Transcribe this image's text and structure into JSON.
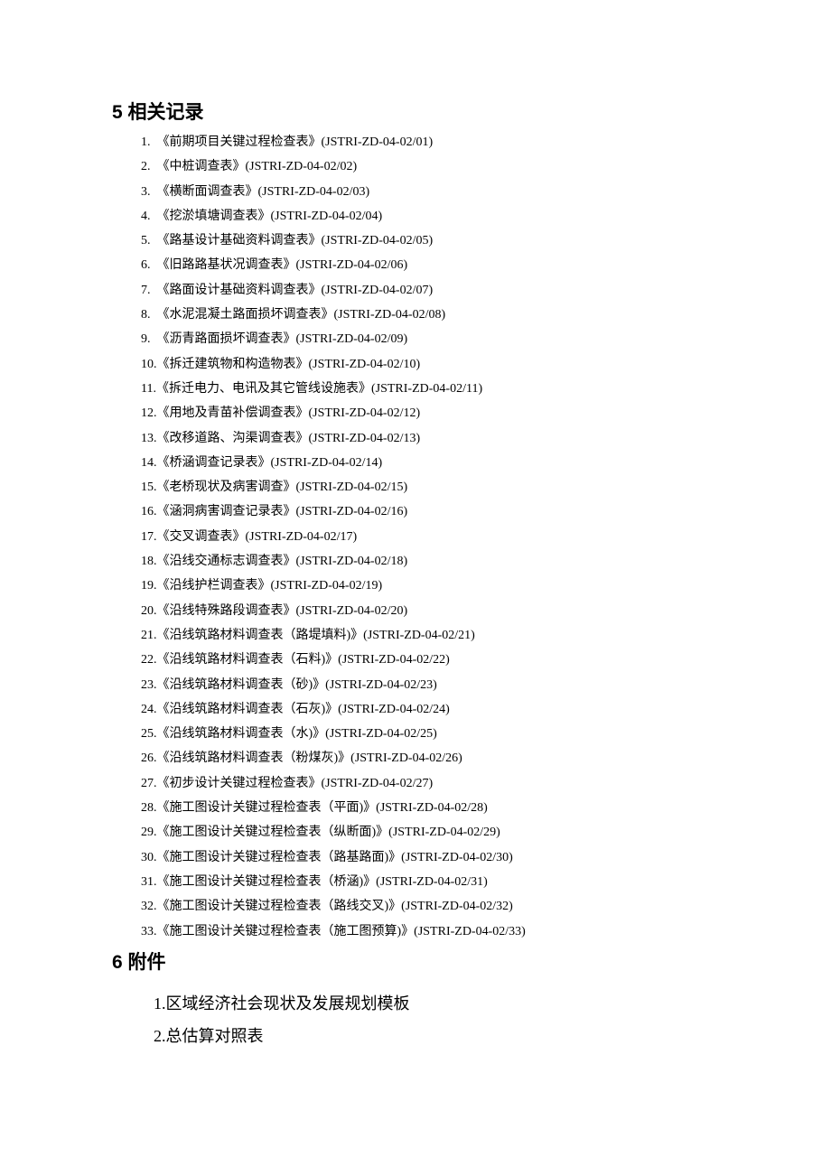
{
  "section5": {
    "heading": "5 相关记录",
    "items": [
      {
        "num": "1.",
        "text": "《前期项目关键过程检查表》(JSTRI-ZD-04-02/01)"
      },
      {
        "num": "2.",
        "text": "《中桩调查表》(JSTRI-ZD-04-02/02)"
      },
      {
        "num": "3.",
        "text": "《横断面调查表》(JSTRI-ZD-04-02/03)"
      },
      {
        "num": "4.",
        "text": "《挖淤填塘调查表》(JSTRI-ZD-04-02/04)"
      },
      {
        "num": "5.",
        "text": "《路基设计基础资料调查表》(JSTRI-ZD-04-02/05)"
      },
      {
        "num": "6.",
        "text": "《旧路路基状况调查表》(JSTRI-ZD-04-02/06)"
      },
      {
        "num": "7.",
        "text": "《路面设计基础资料调查表》(JSTRI-ZD-04-02/07)"
      },
      {
        "num": "8.",
        "text": "《水泥混凝土路面损坏调查表》(JSTRI-ZD-04-02/08)"
      },
      {
        "num": "9.",
        "text": "《沥青路面损坏调查表》(JSTRI-ZD-04-02/09)"
      },
      {
        "num": "10.",
        "text": "《拆迁建筑物和构造物表》(JSTRI-ZD-04-02/10)"
      },
      {
        "num": "11.",
        "text": "《拆迁电力、电讯及其它管线设施表》(JSTRI-ZD-04-02/11)"
      },
      {
        "num": "12.",
        "text": "《用地及青苗补偿调查表》(JSTRI-ZD-04-02/12)"
      },
      {
        "num": "13.",
        "text": "《改移道路、沟渠调查表》(JSTRI-ZD-04-02/13)"
      },
      {
        "num": "14.",
        "text": "《桥涵调查记录表》(JSTRI-ZD-04-02/14)"
      },
      {
        "num": "15.",
        "text": "《老桥现状及病害调查》(JSTRI-ZD-04-02/15)"
      },
      {
        "num": "16.",
        "text": "《涵洞病害调查记录表》(JSTRI-ZD-04-02/16)"
      },
      {
        "num": "17.",
        "text": "《交叉调查表》(JSTRI-ZD-04-02/17)"
      },
      {
        "num": "18.",
        "text": "《沿线交通标志调查表》(JSTRI-ZD-04-02/18)"
      },
      {
        "num": "19.",
        "text": "《沿线护栏调查表》(JSTRI-ZD-04-02/19)"
      },
      {
        "num": "20.",
        "text": "《沿线特殊路段调查表》(JSTRI-ZD-04-02/20)"
      },
      {
        "num": "21.",
        "text": "《沿线筑路材料调查表（路堤填料)》(JSTRI-ZD-04-02/21)"
      },
      {
        "num": "22.",
        "text": "《沿线筑路材料调查表（石料)》(JSTRI-ZD-04-02/22)"
      },
      {
        "num": "23.",
        "text": "《沿线筑路材料调查表（砂)》(JSTRI-ZD-04-02/23)"
      },
      {
        "num": "24.",
        "text": "《沿线筑路材料调查表（石灰)》(JSTRI-ZD-04-02/24)"
      },
      {
        "num": "25.",
        "text": "《沿线筑路材料调查表（水)》(JSTRI-ZD-04-02/25)"
      },
      {
        "num": "26.",
        "text": "《沿线筑路材料调查表（粉煤灰)》(JSTRI-ZD-04-02/26)"
      },
      {
        "num": "27.",
        "text": "《初步设计关键过程检查表》(JSTRI-ZD-04-02/27)"
      },
      {
        "num": "28.",
        "text": "《施工图设计关键过程检查表（平面)》(JSTRI-ZD-04-02/28)"
      },
      {
        "num": "29.",
        "text": "《施工图设计关键过程检查表（纵断面)》(JSTRI-ZD-04-02/29)"
      },
      {
        "num": "30.",
        "text": "《施工图设计关键过程检查表（路基路面)》(JSTRI-ZD-04-02/30)"
      },
      {
        "num": "31.",
        "text": "《施工图设计关键过程检查表（桥涵)》(JSTRI-ZD-04-02/31)"
      },
      {
        "num": "32.",
        "text": "《施工图设计关键过程检查表（路线交叉)》(JSTRI-ZD-04-02/32)"
      },
      {
        "num": "33.",
        "text": "《施工图设计关键过程检查表（施工图预算)》(JSTRI-ZD-04-02/33)"
      }
    ]
  },
  "section6": {
    "heading": "6 附件",
    "items": [
      {
        "num": "1.",
        "text": "区域经济社会现状及发展规划模板"
      },
      {
        "num": "2.",
        "text": "总估算对照表"
      }
    ]
  }
}
